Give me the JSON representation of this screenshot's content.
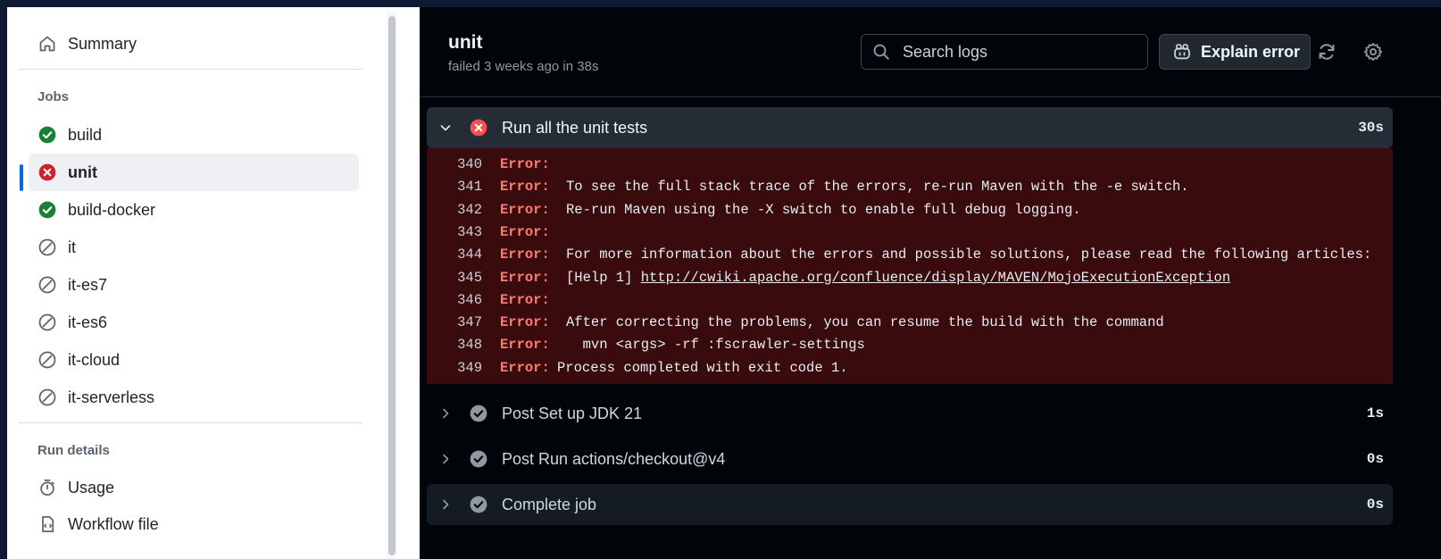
{
  "sidebar": {
    "summary_label": "Summary",
    "jobs_heading": "Jobs",
    "jobs": [
      {
        "label": "build",
        "status": "success"
      },
      {
        "label": "unit",
        "status": "failure"
      },
      {
        "label": "build-docker",
        "status": "success"
      },
      {
        "label": "it",
        "status": "skipped"
      },
      {
        "label": "it-es7",
        "status": "skipped"
      },
      {
        "label": "it-es6",
        "status": "skipped"
      },
      {
        "label": "it-cloud",
        "status": "skipped"
      },
      {
        "label": "it-serverless",
        "status": "skipped"
      }
    ],
    "run_details_heading": "Run details",
    "usage_label": "Usage",
    "workflow_file_label": "Workflow file"
  },
  "header": {
    "title": "unit",
    "subtitle": "failed 3 weeks ago in 38s",
    "search_placeholder": "Search logs",
    "explain_label": "Explain error"
  },
  "steps": [
    {
      "name": "Run all the unit tests",
      "duration": "30s",
      "status": "failure",
      "expanded": true
    },
    {
      "name": "Post Set up JDK 21",
      "duration": "1s",
      "status": "success",
      "expanded": false
    },
    {
      "name": "Post Run actions/checkout@v4",
      "duration": "0s",
      "status": "success",
      "expanded": false
    },
    {
      "name": "Complete job",
      "duration": "0s",
      "status": "success",
      "expanded": false
    }
  ],
  "log_lines": [
    {
      "num": "340",
      "prefix": "Error:",
      "text": ""
    },
    {
      "num": "341",
      "prefix": "Error:",
      "text": "To see the full stack trace of the errors, re-run Maven with the -e switch."
    },
    {
      "num": "342",
      "prefix": "Error:",
      "text": "Re-run Maven using the -X switch to enable full debug logging."
    },
    {
      "num": "343",
      "prefix": "Error:",
      "text": ""
    },
    {
      "num": "344",
      "prefix": "Error:",
      "text": "For more information about the errors and possible solutions, please read the following articles:"
    },
    {
      "num": "345",
      "prefix": "Error:",
      "text": "[Help 1] ",
      "link": "http://cwiki.apache.org/confluence/display/MAVEN/MojoExecutionException"
    },
    {
      "num": "346",
      "prefix": "Error:",
      "text": ""
    },
    {
      "num": "347",
      "prefix": "Error:",
      "text": "After correcting the problems, you can resume the build with the command"
    },
    {
      "num": "348",
      "prefix": "Error:",
      "text": "  mvn <args> -rf :fscrawler-settings"
    },
    {
      "num": "349",
      "prefix": "Error:",
      "text": "Process completed with exit code 1."
    }
  ],
  "colors": {
    "success": "#1a7f37",
    "failure": "#cf222e",
    "skipped": "#59636e",
    "accent": "#0969da",
    "log_background": "#3a0b0c",
    "error_text": "#ff7b72"
  }
}
